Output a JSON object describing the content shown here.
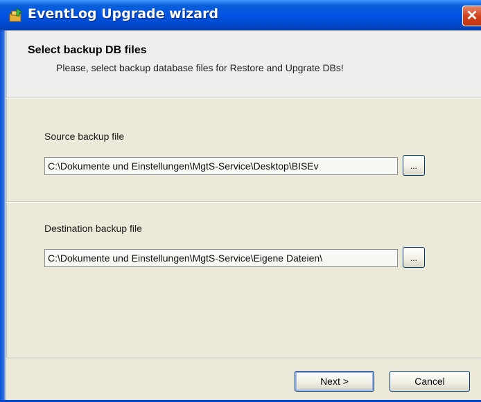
{
  "window": {
    "title": "EventLog Upgrade wizard",
    "close_label": "✕"
  },
  "header": {
    "title": "Select backup DB files",
    "description": "Please, select backup database files for Restore and Upgrate DBs!"
  },
  "source": {
    "label": "Source backup file",
    "value": "C:\\Dokumente und Einstellungen\\MgtS-Service\\Desktop\\BISEv",
    "browse_label": "..."
  },
  "destination": {
    "label": "Destination backup file",
    "value": "C:\\Dokumente und Einstellungen\\MgtS-Service\\Eigene Dateien\\",
    "browse_label": "..."
  },
  "footer": {
    "next_label": "Next >",
    "cancel_label": "Cancel"
  },
  "colors": {
    "titlebar": "#0054e3",
    "dialog_bg": "#ece9d8",
    "header_bg": "#eeeeec",
    "close_button": "#d1441f"
  }
}
